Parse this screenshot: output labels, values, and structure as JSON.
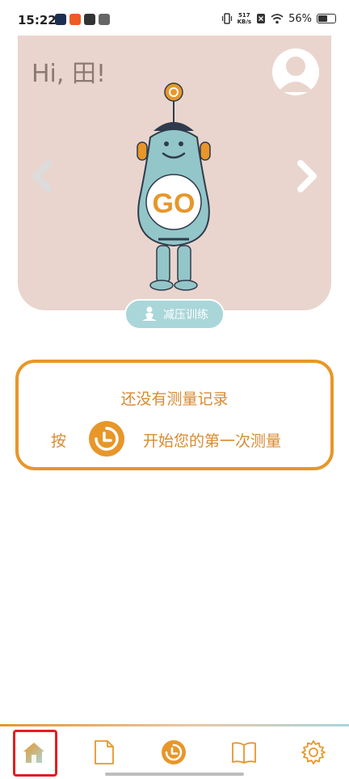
{
  "status_bar": {
    "time": "15:22",
    "net_speed_value": "517",
    "net_speed_unit": "KB/s",
    "battery_percent": "56%",
    "battery_level": 0.56
  },
  "hero": {
    "greeting": "Hi, 田!",
    "robot_button": "GO",
    "relax_button_label": "减压训练"
  },
  "empty_state": {
    "title": "还没有测量记录",
    "press_text": "按",
    "start_text": "开始您的第一次测量"
  },
  "colors": {
    "accent": "#e8962a",
    "hero_bg": "#e9d5cd",
    "teal": "#a9d6d9",
    "highlight": "#e21e1e"
  },
  "bottom_nav": {
    "tabs": [
      "home-icon",
      "document-icon",
      "measure-icon",
      "book-icon",
      "gear-icon"
    ],
    "active": "home-icon"
  }
}
